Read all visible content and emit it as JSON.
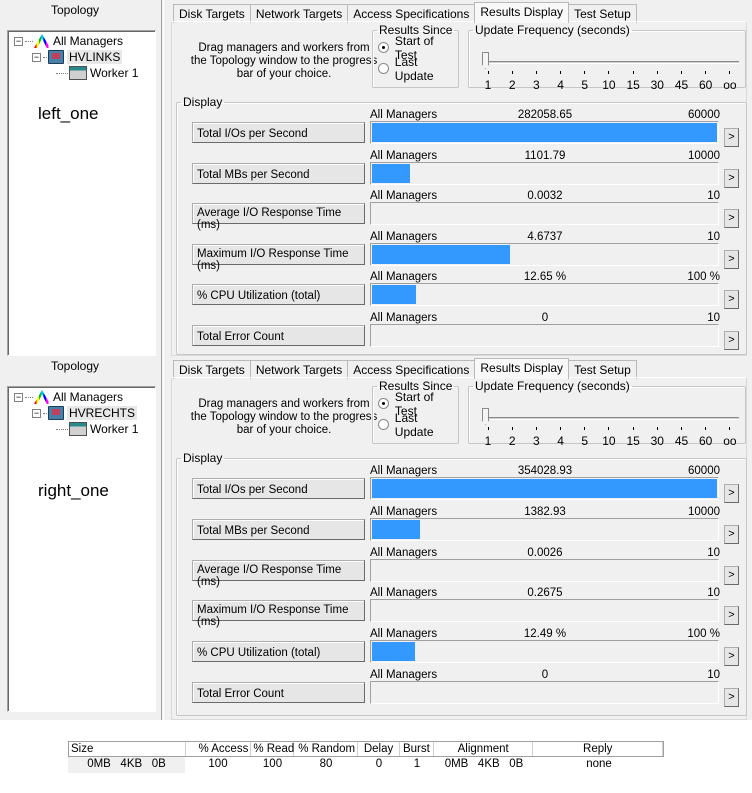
{
  "panels": [
    {
      "topology": {
        "title": "Topology",
        "root": "All Managers",
        "host": "HVLINKS",
        "worker": "Worker 1",
        "caption": "left_one"
      },
      "tabs": [
        "Disk Targets",
        "Network Targets",
        "Access Specifications",
        "Results Display",
        "Test Setup"
      ],
      "active_tab": "Results Display",
      "hint": "Drag managers and workers from the Topology window to the progress bar of your choice.",
      "results_since": {
        "label": "Results Since",
        "options": [
          "Start of Test",
          "Last Update"
        ],
        "selected": "Start of Test"
      },
      "update_frequency": {
        "label": "Update Frequency (seconds)",
        "ticks": [
          "1",
          "2",
          "3",
          "4",
          "5",
          "10",
          "15",
          "30",
          "45",
          "60",
          "oo"
        ],
        "value": "1"
      },
      "display_label": "Display",
      "meters": [
        {
          "button": "Total I/Os per Second",
          "source": "All Managers",
          "value": "282058.65",
          "max": "60000",
          "fill": 1.0
        },
        {
          "button": "Total MBs per Second",
          "source": "All Managers",
          "value": "1101.79",
          "max": "10000",
          "fill": 0.11
        },
        {
          "button": "Average I/O Response Time (ms)",
          "source": "All Managers",
          "value": "0.0032",
          "max": "10",
          "fill": 0.0
        },
        {
          "button": "Maximum I/O Response Time (ms)",
          "source": "All Managers",
          "value": "4.6737",
          "max": "10",
          "fill": 0.4
        },
        {
          "button": "% CPU Utilization (total)",
          "source": "All Managers",
          "value": "12.65 %",
          "max": "100 %",
          "fill": 0.1265
        },
        {
          "button": "Total Error Count",
          "source": "All Managers",
          "value": "0",
          "max": "10",
          "fill": 0.0
        }
      ],
      "arrow_label": ">"
    },
    {
      "topology": {
        "title": "Topology",
        "root": "All Managers",
        "host": "HVRECHTS",
        "worker": "Worker 1",
        "caption": "right_one"
      },
      "tabs": [
        "Disk Targets",
        "Network Targets",
        "Access Specifications",
        "Results Display",
        "Test Setup"
      ],
      "active_tab": "Results Display",
      "hint": "Drag managers and workers from the Topology window to the progress bar of your choice.",
      "results_since": {
        "label": "Results Since",
        "options": [
          "Start of Test",
          "Last Update"
        ],
        "selected": "Start of Test"
      },
      "update_frequency": {
        "label": "Update Frequency (seconds)",
        "ticks": [
          "1",
          "2",
          "3",
          "4",
          "5",
          "10",
          "15",
          "30",
          "45",
          "60",
          "oo"
        ],
        "value": "1"
      },
      "display_label": "Display",
      "meters": [
        {
          "button": "Total I/Os per Second",
          "source": "All Managers",
          "value": "354028.93",
          "max": "60000",
          "fill": 1.0
        },
        {
          "button": "Total MBs per Second",
          "source": "All Managers",
          "value": "1382.93",
          "max": "10000",
          "fill": 0.1383
        },
        {
          "button": "Average I/O Response Time (ms)",
          "source": "All Managers",
          "value": "0.0026",
          "max": "10",
          "fill": 0.0
        },
        {
          "button": "Maximum I/O Response Time (ms)",
          "source": "All Managers",
          "value": "0.2675",
          "max": "10",
          "fill": 0.0
        },
        {
          "button": "% CPU Utilization (total)",
          "source": "All Managers",
          "value": "12.49 %",
          "max": "100 %",
          "fill": 0.1249
        },
        {
          "button": "Total Error Count",
          "source": "All Managers",
          "value": "0",
          "max": "10",
          "fill": 0.0
        }
      ],
      "arrow_label": ">"
    }
  ],
  "access_spec": {
    "headers": [
      "Size",
      "% Access",
      "% Read",
      "% Random",
      "Delay",
      "Burst",
      "Alignment",
      "Reply"
    ],
    "row": [
      "0MB   4KB   0B",
      "100",
      "100",
      "80",
      "0",
      "1",
      "0MB   4KB   0B",
      "none"
    ]
  },
  "colors": {
    "bar_fill": "#3399ff",
    "window_bg": "#f0f0f0"
  }
}
